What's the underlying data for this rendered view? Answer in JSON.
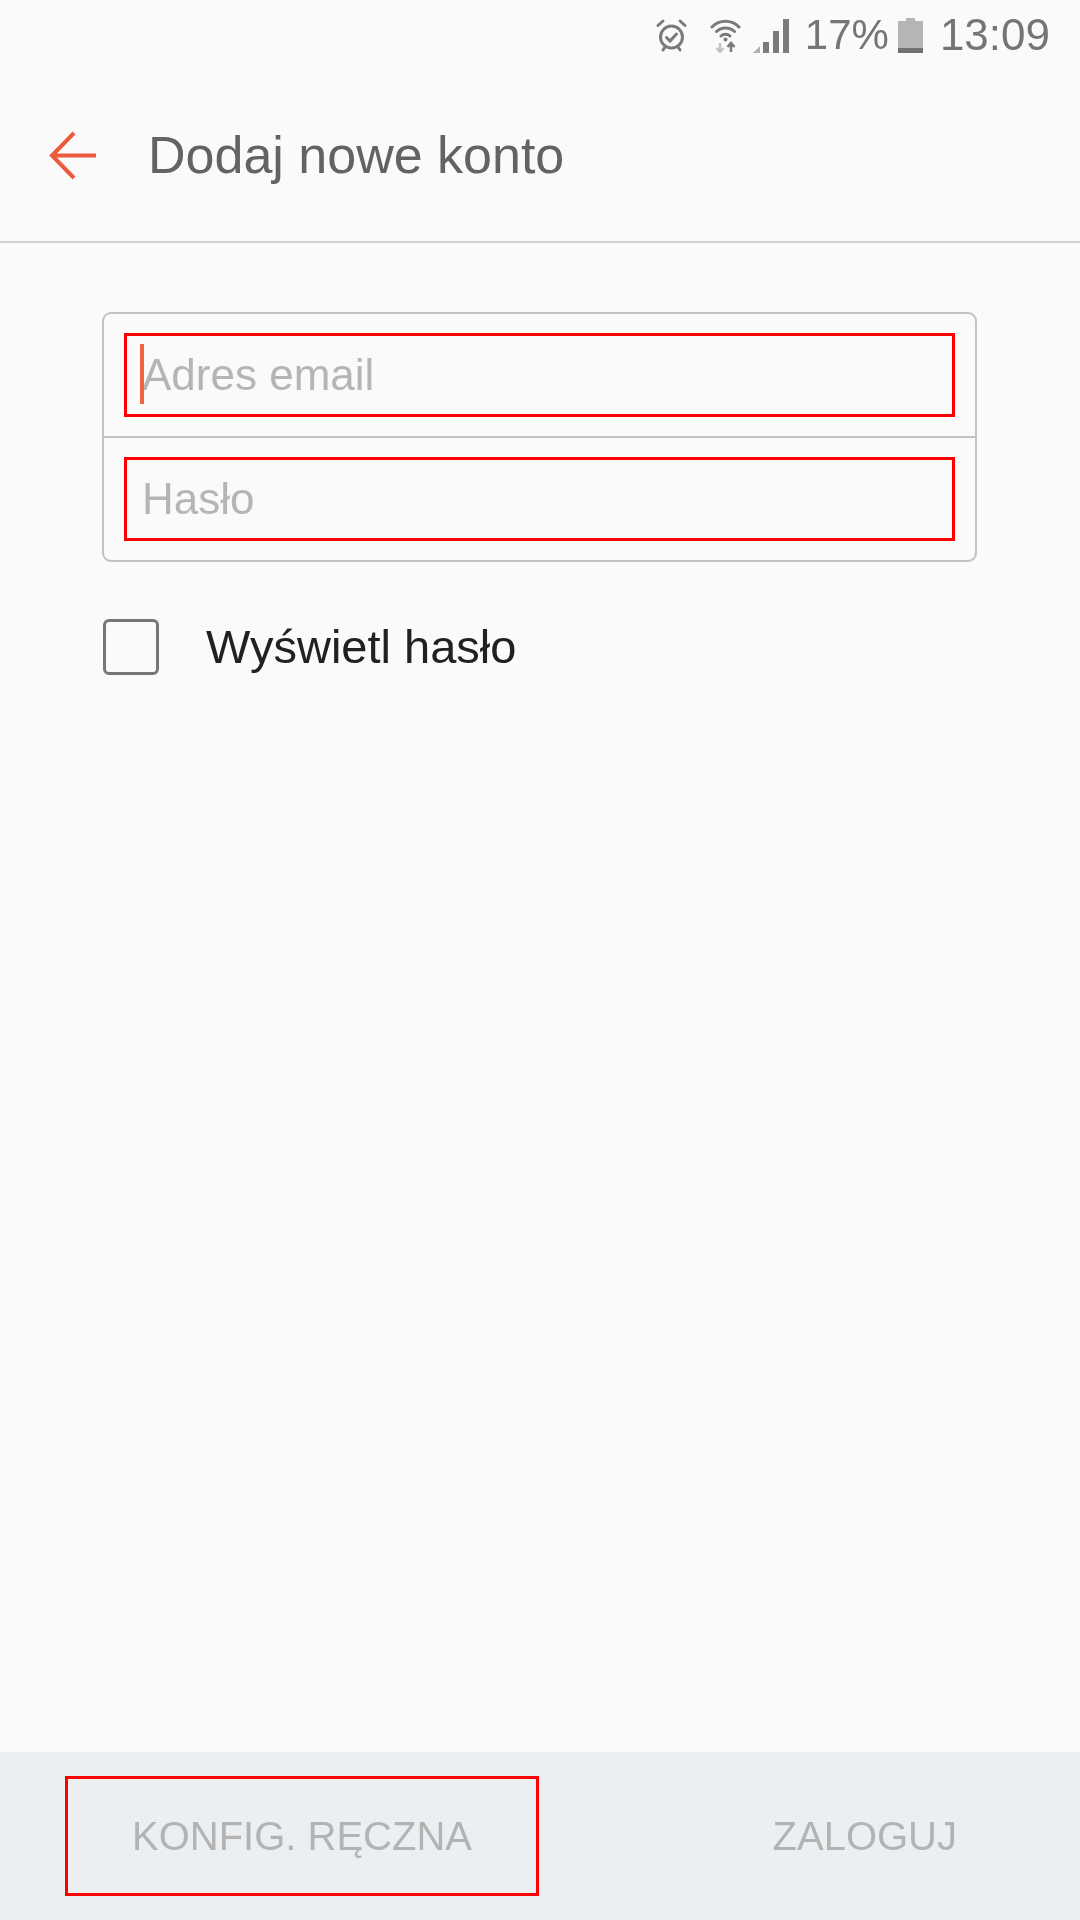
{
  "status_bar": {
    "battery_percent": "17%",
    "time": "13:09"
  },
  "header": {
    "title": "Dodaj nowe konto"
  },
  "fields": [
    {
      "placeholder": "Adres email",
      "focused": true,
      "highlighted": true
    },
    {
      "placeholder": "Hasło",
      "focused": false,
      "highlighted": true
    }
  ],
  "show_password": {
    "label": "Wyświetl hasło",
    "checked": false
  },
  "buttons": [
    {
      "label": "KONFIG. RĘCZNA",
      "disabled": true,
      "highlighted": true
    },
    {
      "label": "ZALOGUJ",
      "disabled": true,
      "highlighted": false
    }
  ]
}
